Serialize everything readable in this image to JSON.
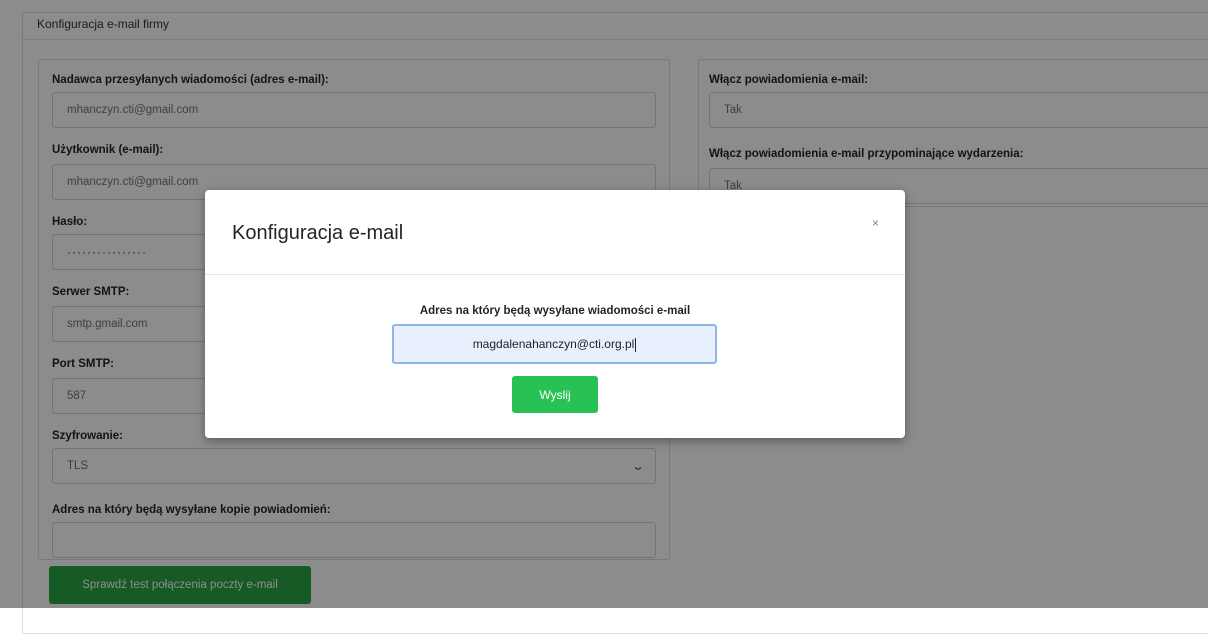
{
  "section": {
    "title": "Konfiguracja e-mail firmy"
  },
  "form": {
    "sender_label": "Nadawca przesyłanych wiadomości (adres e-mail):",
    "sender_value": "mhanczyn.cti@gmail.com",
    "user_label": "Użytkownik (e-mail):",
    "user_value": "mhanczyn.cti@gmail.com",
    "password_label": "Hasło:",
    "password_value": "················",
    "smtp_server_label": "Serwer SMTP:",
    "smtp_server_value": "smtp.gmail.com",
    "smtp_port_label": "Port SMTP:",
    "smtp_port_value": "587",
    "encryption_label": "Szyfrowanie:",
    "encryption_value": "TLS",
    "copy_address_label": "Adres na który będą wysyłane kopie powiadomień:",
    "copy_address_value": "",
    "notifications_label": "Włącz powiadomienia e-mail:",
    "notifications_value": "Tak",
    "reminders_label": "Włącz powiadomienia e-mail przypominające wydarzenia:",
    "reminders_value": "Tak",
    "test_button": "Sprawdź test połączenia poczty e-mail"
  },
  "modal": {
    "title": "Konfiguracja e-mail",
    "close": "×",
    "address_label": "Adres na który będą wysyłane wiadomości e-mail",
    "address_value": "magdalenahanczyn@cti.org.pl",
    "send_button": "Wyslij"
  },
  "icons": {
    "dropdown": "chevron-down-icon",
    "close": "close-icon"
  },
  "colors": {
    "success": "#28a745",
    "modal_button": "#28c254",
    "input_focus": "#8fb5e3"
  }
}
